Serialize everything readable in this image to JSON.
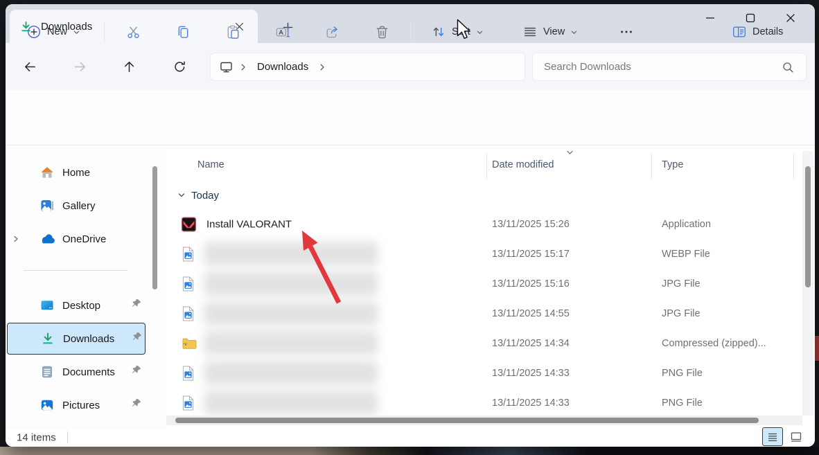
{
  "tab": {
    "title": "Downloads"
  },
  "navigation": {
    "breadcrumb": {
      "root_icon": "this-pc-icon",
      "items": [
        "Downloads"
      ]
    },
    "search": {
      "placeholder": "Search Downloads"
    }
  },
  "toolbar": {
    "new_label": "New",
    "sort_label": "Sort",
    "view_label": "View",
    "details_label": "Details",
    "icon_buttons": [
      "cut-icon",
      "copy-icon",
      "paste-icon",
      "rename-icon",
      "share-icon",
      "delete-icon",
      "more-icon"
    ]
  },
  "sidebar": {
    "items": [
      {
        "label": "Home",
        "icon": "home-icon"
      },
      {
        "label": "Gallery",
        "icon": "gallery-icon"
      },
      {
        "label": "OneDrive",
        "icon": "onedrive-icon",
        "expandable": true
      },
      {
        "label": "Desktop",
        "icon": "desktop-icon",
        "pinned": true
      },
      {
        "label": "Downloads",
        "icon": "downloads-icon",
        "pinned": true,
        "selected": true
      },
      {
        "label": "Documents",
        "icon": "documents-icon",
        "pinned": true
      },
      {
        "label": "Pictures",
        "icon": "pictures-icon",
        "pinned": true
      }
    ]
  },
  "content": {
    "columns": {
      "name": "Name",
      "date": "Date modified",
      "type": "Type"
    },
    "group_label": "Today",
    "rows": [
      {
        "name": "Install VALORANT",
        "blurred": false,
        "icon": "valorant-app-icon",
        "date": "13/11/2025 15:26",
        "type": "Application"
      },
      {
        "name": "",
        "blurred": true,
        "icon": "image-file-icon",
        "date": "13/11/2025 15:17",
        "type": "WEBP File"
      },
      {
        "name": "",
        "blurred": true,
        "icon": "image-file-icon",
        "date": "13/11/2025 15:16",
        "type": "JPG File"
      },
      {
        "name": "",
        "blurred": true,
        "icon": "image-file-icon",
        "date": "13/11/2025 14:55",
        "type": "JPG File"
      },
      {
        "name": "",
        "blurred": true,
        "icon": "zip-file-icon",
        "date": "13/11/2025 14:34",
        "type": "Compressed (zipped)..."
      },
      {
        "name": "",
        "blurred": true,
        "icon": "image-file-icon",
        "date": "13/11/2025 14:33",
        "type": "PNG File"
      },
      {
        "name": "",
        "blurred": true,
        "icon": "image-file-icon",
        "date": "13/11/2025 14:33",
        "type": "PNG File"
      }
    ]
  },
  "statusbar": {
    "items_count": "14 items"
  },
  "annotation": {
    "type": "red-arrow",
    "color": "#e0393d",
    "points_to": "Install VALORANT"
  },
  "colors": {
    "selection_blue": "#cde8fb",
    "valorant_red": "#ff4655",
    "download_green": "#1ca06e",
    "download_teal": "#00b39b",
    "accent_blue": "#4f82dd",
    "titlebar_grey": "#d8dce4"
  }
}
